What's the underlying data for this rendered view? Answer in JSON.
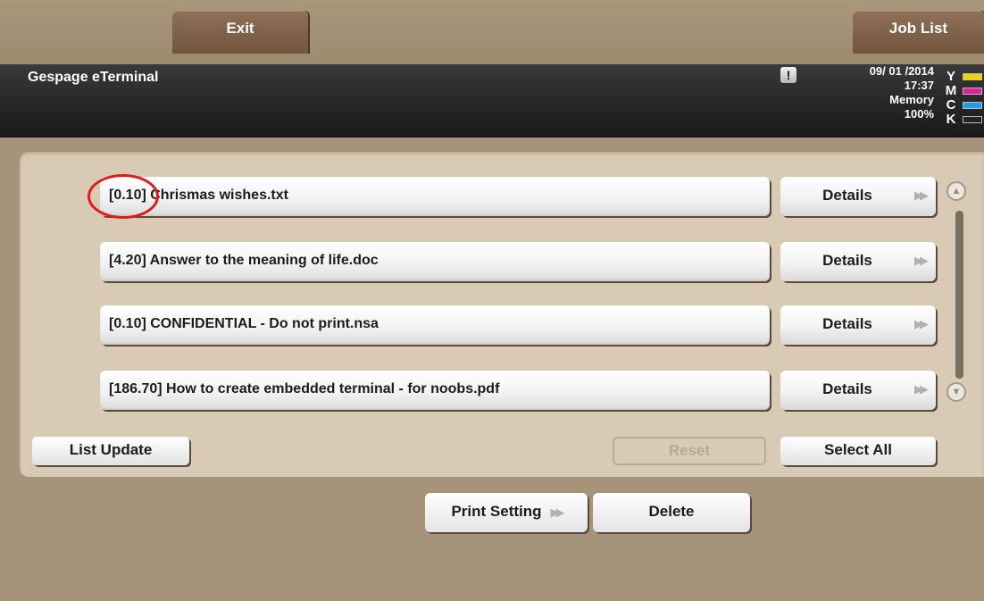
{
  "top": {
    "exit_label": "Exit",
    "joblist_label": "Job List"
  },
  "header": {
    "title": "Gespage eTerminal",
    "warning_icon": "!",
    "date": "09/ 01 /2014",
    "time": "17:37",
    "memory_label": "Memory",
    "memory_value": "100%",
    "toner": [
      {
        "label": "Y",
        "color": "#f2d200"
      },
      {
        "label": "M",
        "color": "#e01ea0"
      },
      {
        "label": "C",
        "color": "#1aa0e6"
      },
      {
        "label": "K",
        "color": "#222222"
      }
    ]
  },
  "files": [
    {
      "name": "[0.10] Chrismas wishes.txt",
      "details": "Details"
    },
    {
      "name": "[4.20] Answer to the meaning of life.doc",
      "details": "Details"
    },
    {
      "name": "[0.10] CONFIDENTIAL - Do not print.nsa",
      "details": "Details"
    },
    {
      "name": "[186.70] How to create embedded terminal - for noobs.pdf",
      "details": "Details"
    }
  ],
  "actions": {
    "list_update": "List Update",
    "reset": "Reset",
    "select_all": "Select All",
    "print_setting": "Print Setting",
    "delete": "Delete"
  },
  "icons": {
    "details_arrow": "double-chevron-right-icon",
    "scroll_up": "scroll-up-icon",
    "scroll_down": "scroll-down-icon"
  }
}
